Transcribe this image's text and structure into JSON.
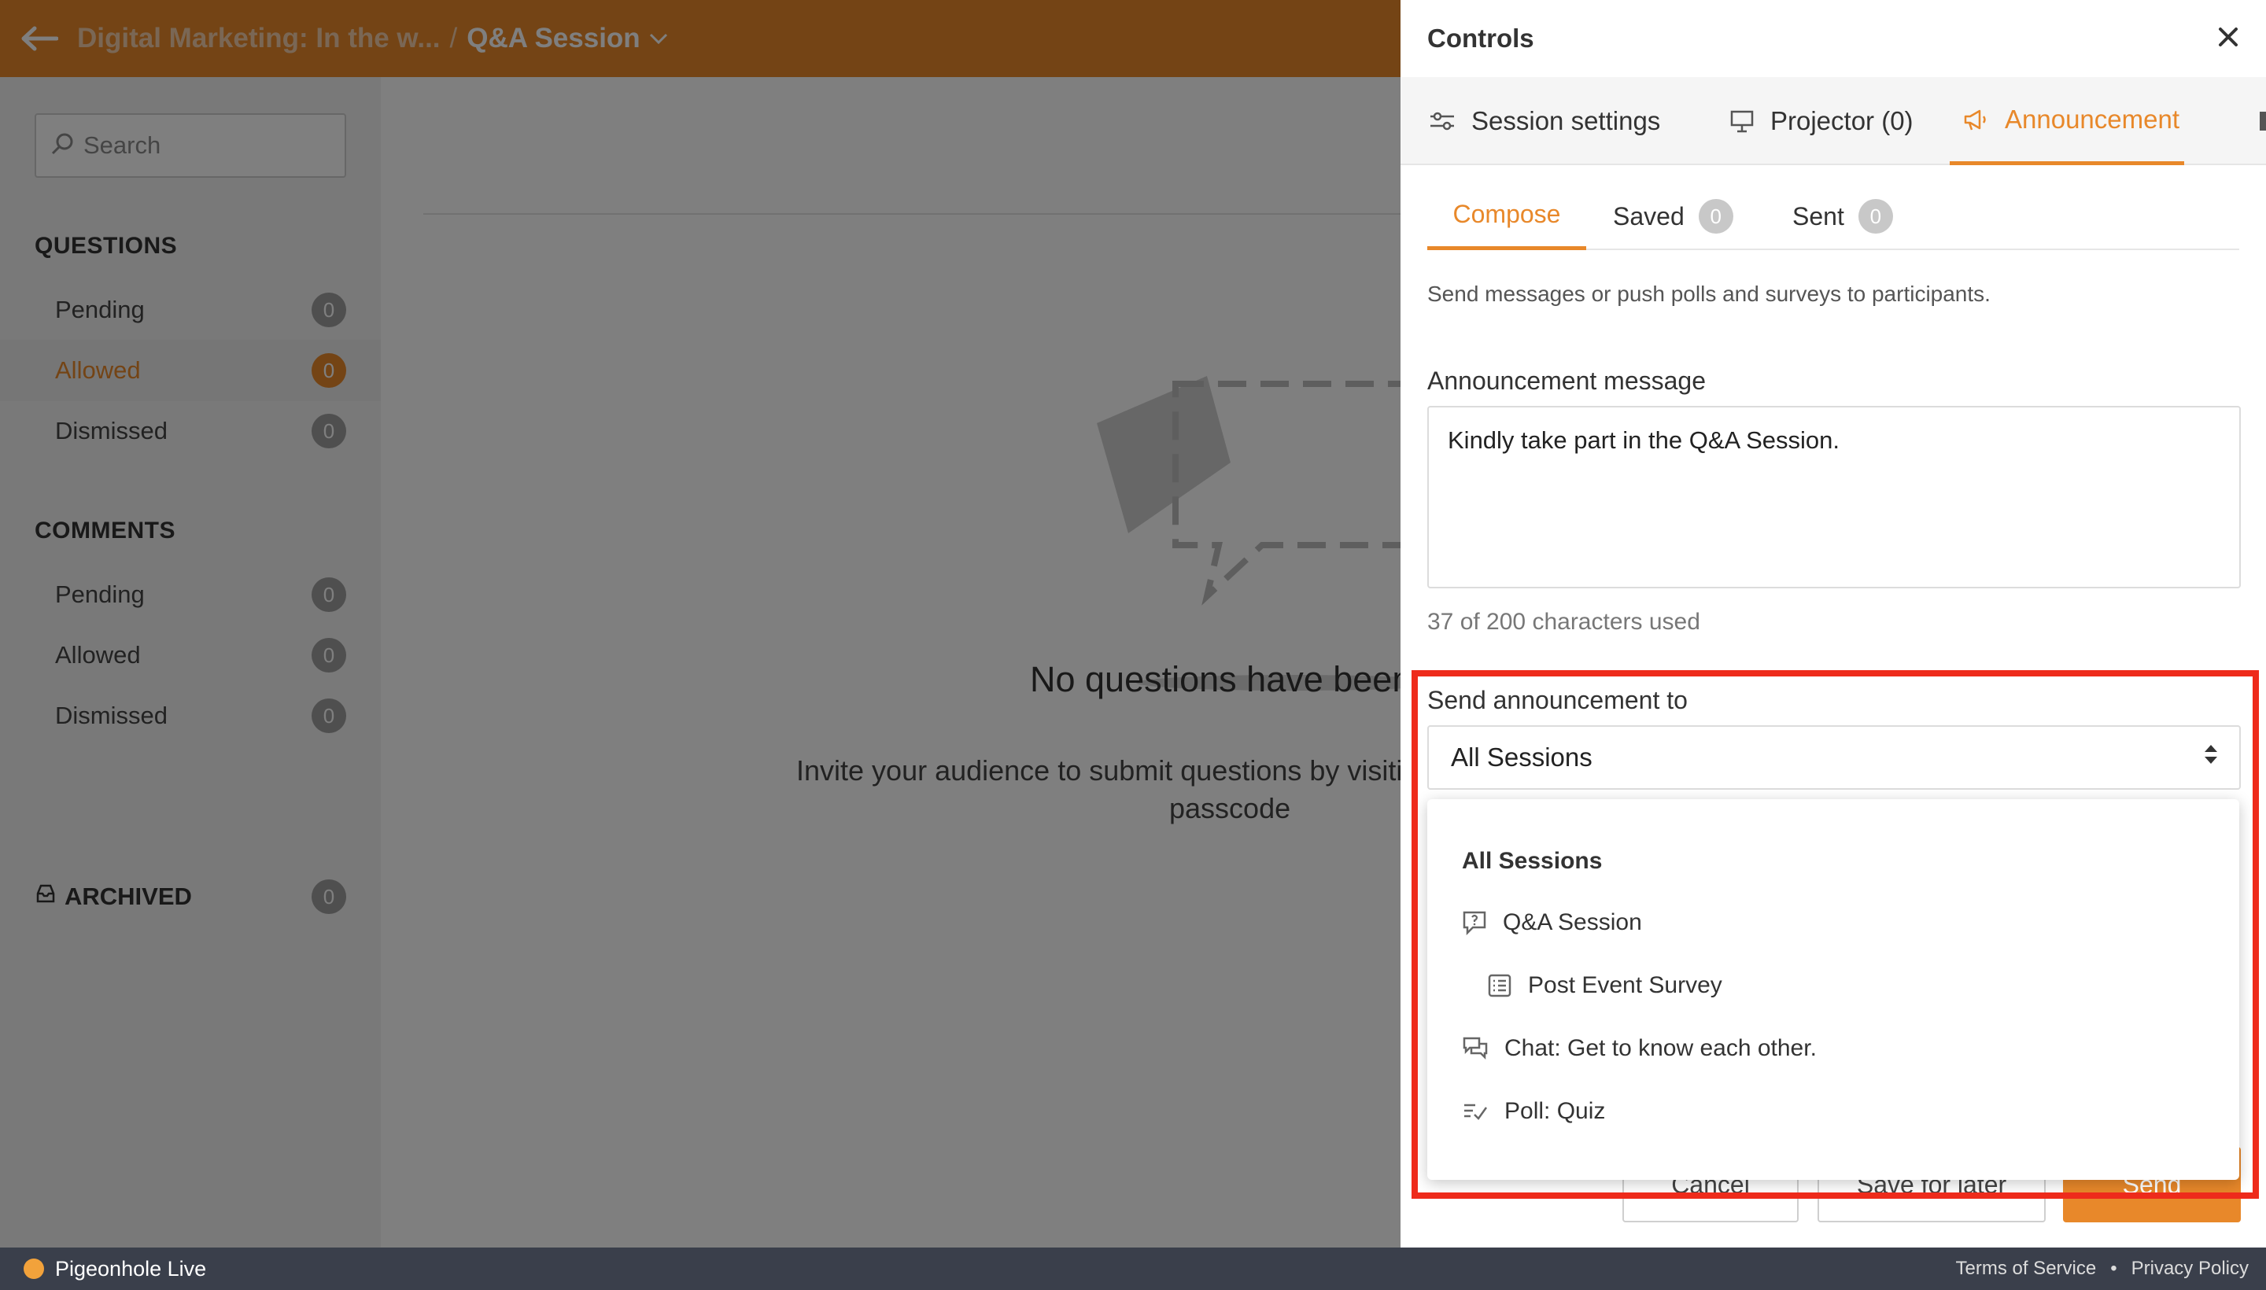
{
  "topbar": {
    "back_icon": "arrow-left-icon",
    "event_name": "Digital Marketing: In the w...",
    "separator": "/",
    "session_name": "Q&A Session"
  },
  "sidebar": {
    "search_placeholder": "Search",
    "questions": {
      "title": "QUESTIONS",
      "items": [
        {
          "label": "Pending",
          "count": "0"
        },
        {
          "label": "Allowed",
          "count": "0"
        },
        {
          "label": "Dismissed",
          "count": "0"
        }
      ]
    },
    "comments": {
      "title": "COMMENTS",
      "items": [
        {
          "label": "Pending",
          "count": "0"
        },
        {
          "label": "Allowed",
          "count": "0"
        },
        {
          "label": "Dismissed",
          "count": "0"
        }
      ]
    },
    "archived": {
      "label": "ARCHIVED",
      "count": "0"
    }
  },
  "main": {
    "empty_title": "No questions have been",
    "empty_sub_line1": "Invite your audience to submit questions by visitin",
    "empty_sub_line2": "passcode"
  },
  "controls": {
    "title": "Controls",
    "tabs": [
      {
        "label": "Session settings",
        "icon": "sliders-icon"
      },
      {
        "label": "Projector (0)",
        "icon": "projector-icon"
      },
      {
        "label": "Announcement",
        "icon": "megaphone-icon"
      }
    ],
    "subtabs": [
      {
        "label": "Compose"
      },
      {
        "label": "Saved",
        "count": "0"
      },
      {
        "label": "Sent",
        "count": "0"
      }
    ],
    "help_text": "Send messages or push polls and surveys to participants.",
    "message_label": "Announcement message",
    "message_value": "Kindly take part in the Q&A Session.",
    "counter": "37 of 200 characters used",
    "send_to_label": "Send announcement to",
    "send_to_value": "All Sessions",
    "buttons": {
      "cancel": "Cancel",
      "save_later": "Save for later",
      "send": "Send"
    }
  },
  "dropdown": {
    "header": "All Sessions",
    "options": [
      {
        "label": "Q&A Session",
        "icon": "question-bubble-icon"
      },
      {
        "label": "Post Event Survey",
        "icon": "survey-list-icon"
      },
      {
        "label": "Chat: Get to know each other.",
        "icon": "chat-bubbles-icon"
      },
      {
        "label": "Poll: Quiz",
        "icon": "poll-icon"
      }
    ]
  },
  "footer": {
    "brand": "Pigeonhole Live",
    "terms": "Terms of Service",
    "dot": "•",
    "privacy": "Privacy Policy"
  },
  "colors": {
    "accent": "#e8882a",
    "highlight": "#ee2b1b",
    "footer": "#3a3f4b"
  }
}
